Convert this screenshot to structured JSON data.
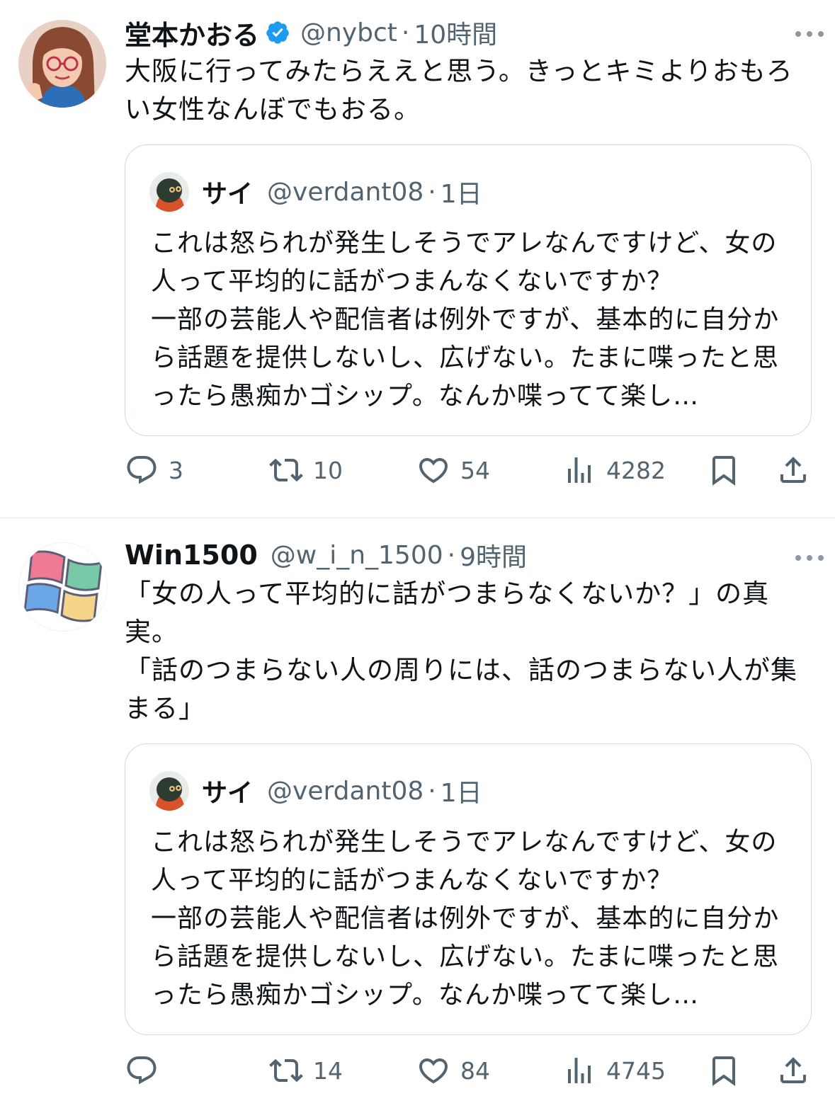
{
  "tweets": [
    {
      "author": {
        "name": "堂本かおる",
        "handle": "@nybct",
        "verified": true
      },
      "separator": "·",
      "time": "10時間",
      "text": "大阪に行ってみたらええと思う。きっとキミよりおもろい女性なんぼでもおる。",
      "quote": {
        "author_name": "サイ",
        "author_handle": "@verdant08",
        "separator": "·",
        "time": "1日",
        "text": "これは怒られが発生しそうでアレなんですけど、女の人って平均的に話がつまんなくないですか？\n一部の芸能人や配信者は例外ですが、基本的に自分から話題を提供しないし、広げない。たまに喋ったと思ったら愚痴かゴシップ。なんか喋ってて楽し…"
      },
      "actions": {
        "replies": "3",
        "reposts": "10",
        "likes": "54",
        "views": "4282"
      }
    },
    {
      "author": {
        "name": "Win1500",
        "handle": "@w_i_n_1500",
        "verified": false
      },
      "separator": "·",
      "time": "9時間",
      "text": "「女の人って平均的に話がつまらなくないか？」の真実。\n「話のつまらない人の周りには、話のつまらない人が集まる」",
      "quote": {
        "author_name": "サイ",
        "author_handle": "@verdant08",
        "separator": "·",
        "time": "1日",
        "text": "これは怒られが発生しそうでアレなんですけど、女の人って平均的に話がつまんなくないですか？\n一部の芸能人や配信者は例外ですが、基本的に自分から話題を提供しないし、広げない。たまに喋ったと思ったら愚痴かゴシップ。なんか喋ってて楽し…"
      },
      "actions": {
        "replies": "",
        "reposts": "14",
        "likes": "84",
        "views": "4745"
      }
    }
  ],
  "colors": {
    "text": "#0f1419",
    "secondary": "#536471",
    "border": "#cfd9de",
    "verified": "#1d9bf0"
  },
  "icons": {
    "reply": "speech-bubble-icon",
    "repost": "repost-arrows-icon",
    "like": "heart-icon",
    "views": "bar-chart-icon",
    "bookmark": "bookmark-icon",
    "share": "share-upload-icon",
    "more": "more-dots-icon",
    "verified": "verified-badge-icon"
  }
}
